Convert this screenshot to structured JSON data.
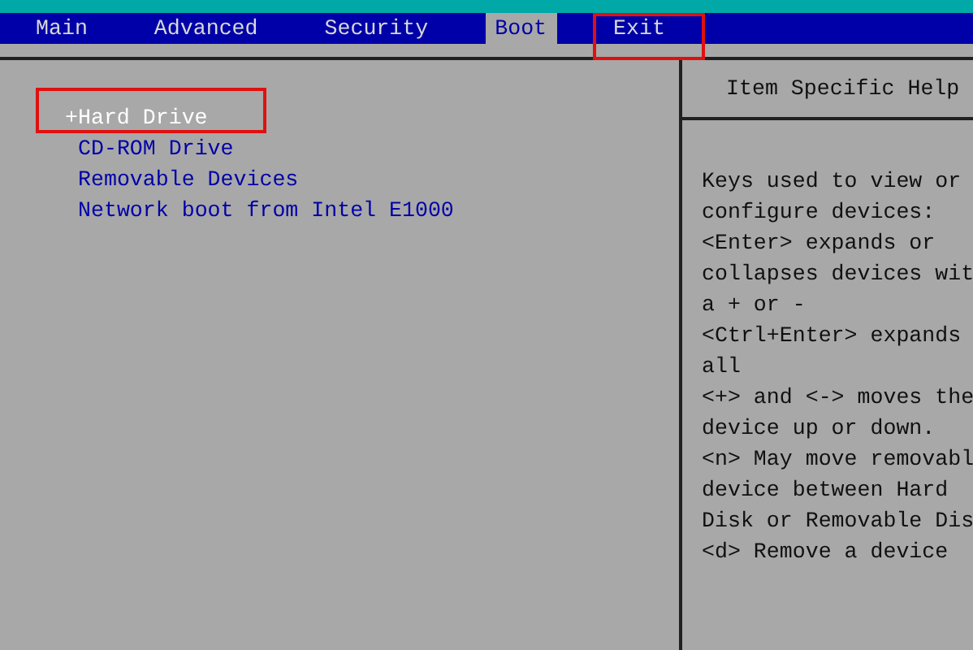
{
  "menu_bar": {
    "tabs": [
      {
        "label": "Main",
        "selected": false,
        "annotated": false
      },
      {
        "label": "Advanced",
        "selected": false,
        "annotated": false
      },
      {
        "label": "Security",
        "selected": false,
        "annotated": false
      },
      {
        "label": "Boot",
        "selected": true,
        "annotated": false
      },
      {
        "label": "Exit",
        "selected": false,
        "annotated": true
      }
    ]
  },
  "boot_order": {
    "items": [
      {
        "label": "+Hard Drive",
        "selected": true,
        "annotated": true
      },
      {
        "label": "CD-ROM Drive",
        "selected": false,
        "annotated": false
      },
      {
        "label": "Removable Devices",
        "selected": false,
        "annotated": false
      },
      {
        "label": "Network boot from Intel E1000",
        "selected": false,
        "annotated": false
      }
    ]
  },
  "help_panel": {
    "title": "Item Specific Help",
    "lines": [
      "Keys used to view or",
      "configure devices:",
      "<Enter> expands or",
      "collapses devices wit",
      "a + or -",
      "<Ctrl+Enter> expands",
      "all",
      "<+> and <-> moves the",
      "device up or down.",
      "<n> May move removabl",
      "device between Hard",
      "Disk or Removable Dis",
      "<d> Remove a device"
    ]
  }
}
